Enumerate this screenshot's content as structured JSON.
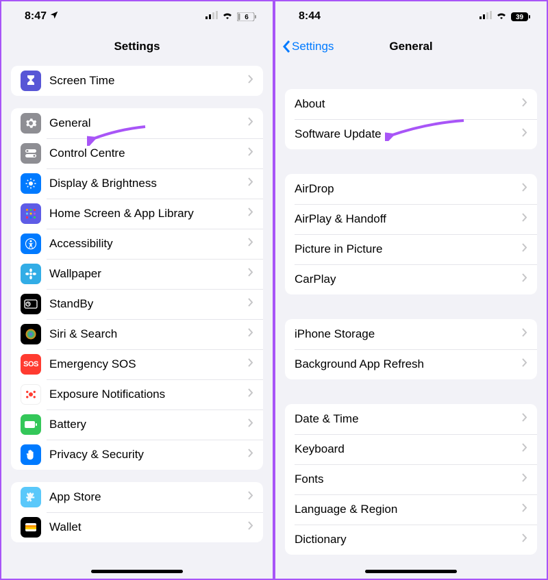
{
  "left": {
    "status": {
      "time": "8:47",
      "battery": "6"
    },
    "title": "Settings",
    "group0": [
      {
        "label": "Screen Time",
        "icon": "hourglass-icon"
      }
    ],
    "group1": [
      {
        "label": "General",
        "icon": "gear-icon"
      },
      {
        "label": "Control Centre",
        "icon": "toggles-icon"
      },
      {
        "label": "Display & Brightness",
        "icon": "brightness-icon"
      },
      {
        "label": "Home Screen & App Library",
        "icon": "grid-icon"
      },
      {
        "label": "Accessibility",
        "icon": "accessibility-icon"
      },
      {
        "label": "Wallpaper",
        "icon": "flower-icon"
      },
      {
        "label": "StandBy",
        "icon": "standby-icon"
      },
      {
        "label": "Siri & Search",
        "icon": "siri-icon"
      },
      {
        "label": "Emergency SOS",
        "icon": "sos-icon"
      },
      {
        "label": "Exposure Notifications",
        "icon": "exposure-icon"
      },
      {
        "label": "Battery",
        "icon": "battery-icon"
      },
      {
        "label": "Privacy & Security",
        "icon": "hand-icon"
      }
    ],
    "group2": [
      {
        "label": "App Store",
        "icon": "appstore-icon"
      },
      {
        "label": "Wallet",
        "icon": "wallet-icon"
      }
    ]
  },
  "right": {
    "status": {
      "time": "8:44",
      "battery": "39"
    },
    "back": "Settings",
    "title": "General",
    "group0": [
      {
        "label": "About"
      },
      {
        "label": "Software Update"
      }
    ],
    "group1": [
      {
        "label": "AirDrop"
      },
      {
        "label": "AirPlay & Handoff"
      },
      {
        "label": "Picture in Picture"
      },
      {
        "label": "CarPlay"
      }
    ],
    "group2": [
      {
        "label": "iPhone Storage"
      },
      {
        "label": "Background App Refresh"
      }
    ],
    "group3": [
      {
        "label": "Date & Time"
      },
      {
        "label": "Keyboard"
      },
      {
        "label": "Fonts"
      },
      {
        "label": "Language & Region"
      },
      {
        "label": "Dictionary"
      }
    ]
  },
  "annotations": {
    "arrow_general": true,
    "arrow_software_update": true
  }
}
